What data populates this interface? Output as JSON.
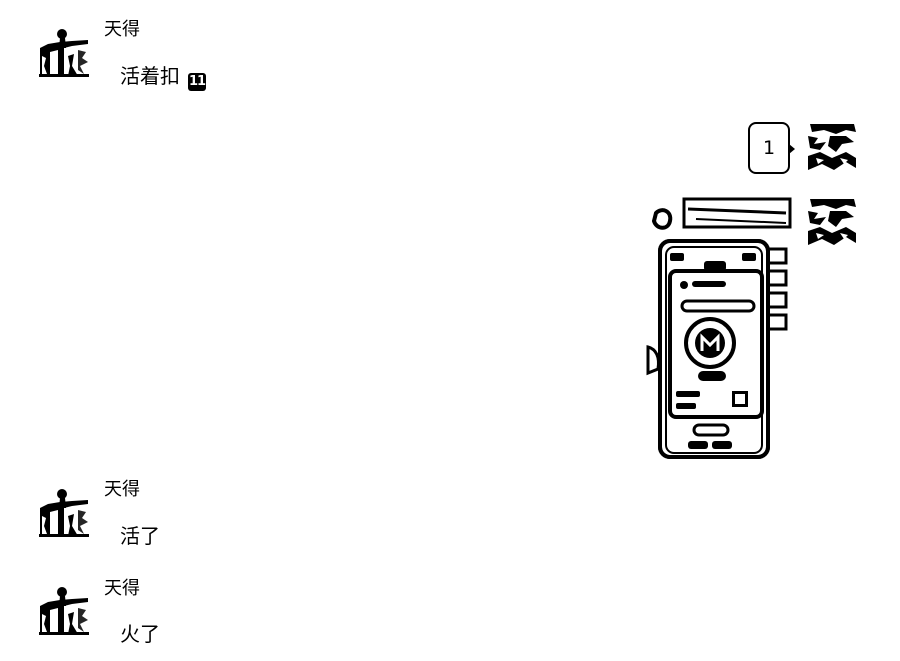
{
  "messages": [
    {
      "sender": "天得",
      "text": "活着扣",
      "emoji_label": "11"
    },
    {
      "text": "1"
    },
    {
      "image_alt": "photo"
    },
    {
      "sender": "天得",
      "text": "活了"
    },
    {
      "sender": "天得",
      "text": "火了"
    }
  ],
  "icons": {
    "left_avatar": "figure-avatar-icon",
    "right_avatar": "landscape-avatar-icon",
    "photo_logo": "m-logo-icon"
  },
  "colors": {
    "background": "#ffffff",
    "ink": "#000000"
  }
}
